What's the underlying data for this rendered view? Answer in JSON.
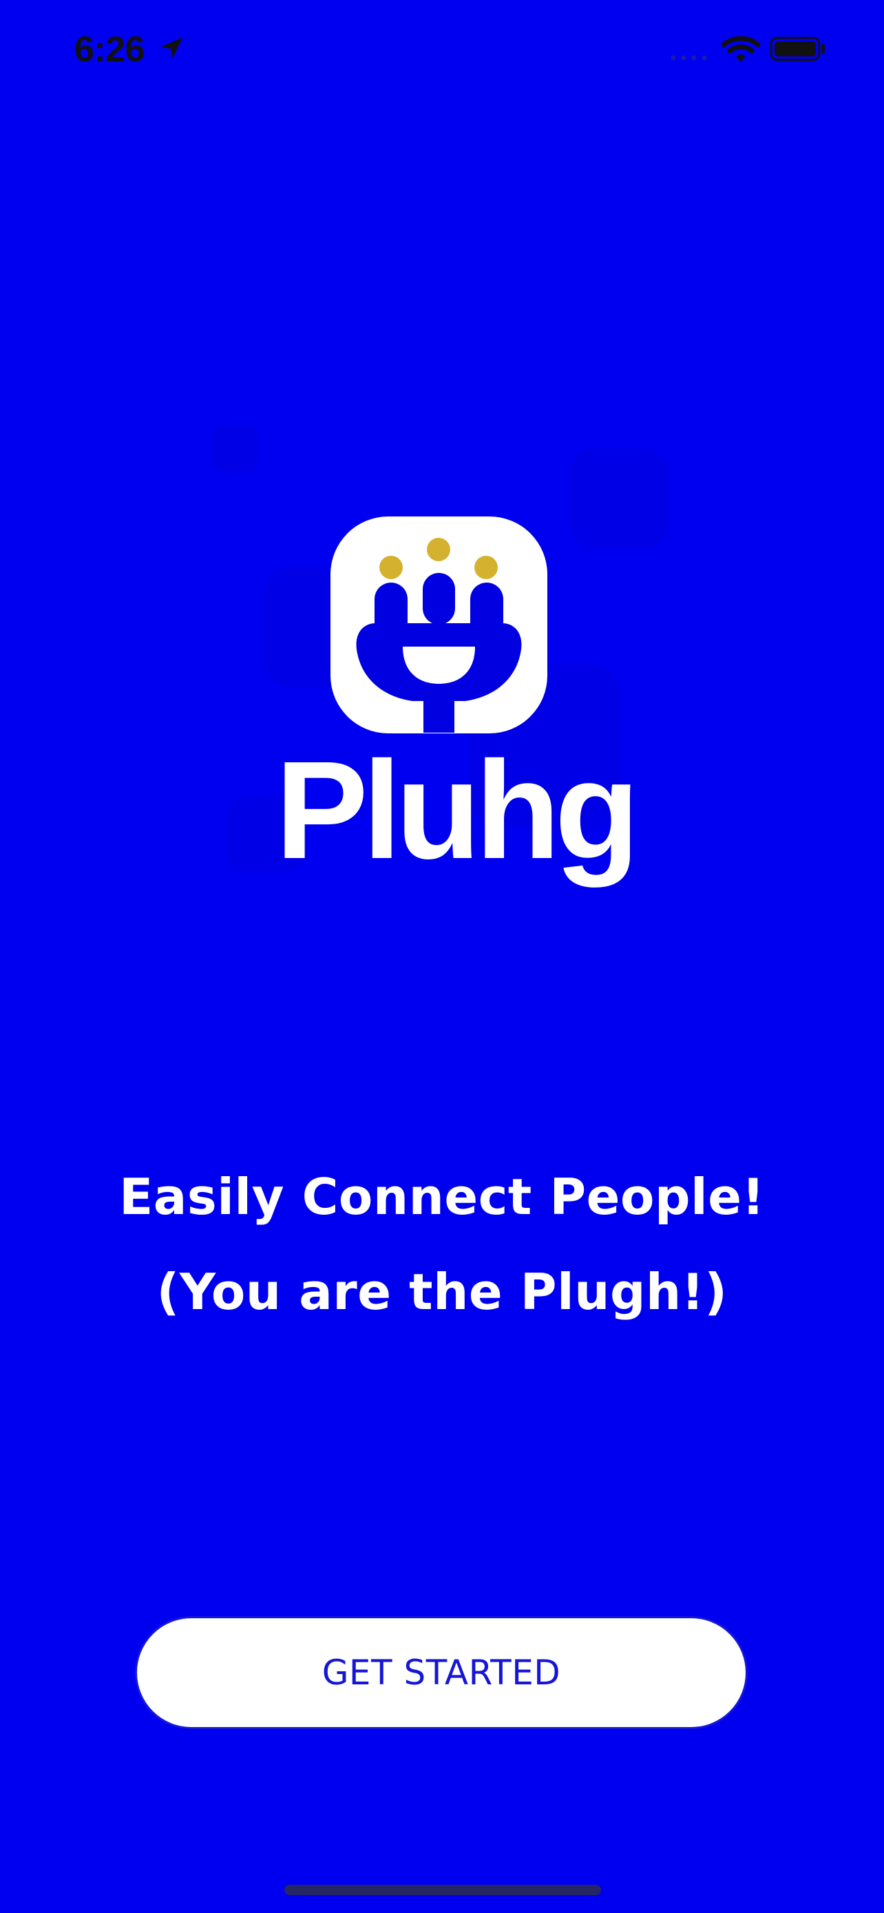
{
  "status_bar": {
    "time": "6:26",
    "icons": [
      "location-arrow-icon",
      "cellular-signal-icon",
      "wifi-icon",
      "battery-icon"
    ]
  },
  "branding": {
    "app_name": "Pluhg",
    "logo_icon": "smiling-plug-icon",
    "colors": {
      "background": "#0000f0",
      "logo_tile": "#ffffff",
      "logo_plug": "#0000e0",
      "logo_dots": "#d4b22f"
    }
  },
  "tagline": {
    "line1": "Easily Connect People!",
    "line2": "(You are the Plugh!)"
  },
  "actions": {
    "get_started_label": "GET STARTED"
  }
}
